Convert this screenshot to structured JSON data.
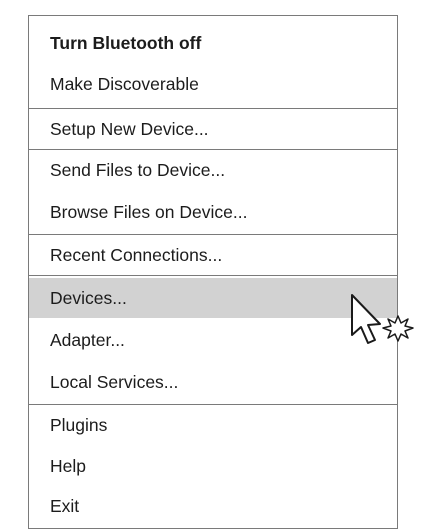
{
  "menu": {
    "items": [
      {
        "label": "Turn Bluetooth off",
        "bold": true,
        "hover": false
      },
      {
        "label": "Make Discoverable",
        "bold": false,
        "hover": false
      },
      {
        "label": "Setup New Device...",
        "bold": false,
        "hover": false
      },
      {
        "label": "Send Files to Device...",
        "bold": false,
        "hover": false
      },
      {
        "label": "Browse Files on Device...",
        "bold": false,
        "hover": false
      },
      {
        "label": "Recent Connections...",
        "bold": false,
        "hover": false
      },
      {
        "label": "Devices...",
        "bold": false,
        "hover": true
      },
      {
        "label": "Adapter...",
        "bold": false,
        "hover": false
      },
      {
        "label": "Local Services...",
        "bold": false,
        "hover": false
      },
      {
        "label": "Plugins",
        "bold": false,
        "hover": false
      },
      {
        "label": "Help",
        "bold": false,
        "hover": false
      },
      {
        "label": "Exit",
        "bold": false,
        "hover": false
      }
    ]
  },
  "cursor": {
    "icon": "click-cursor-icon"
  },
  "colors": {
    "hover_background": "#d2d2d2",
    "separator": "#7a7a7a",
    "text": "#1c1c1c"
  }
}
